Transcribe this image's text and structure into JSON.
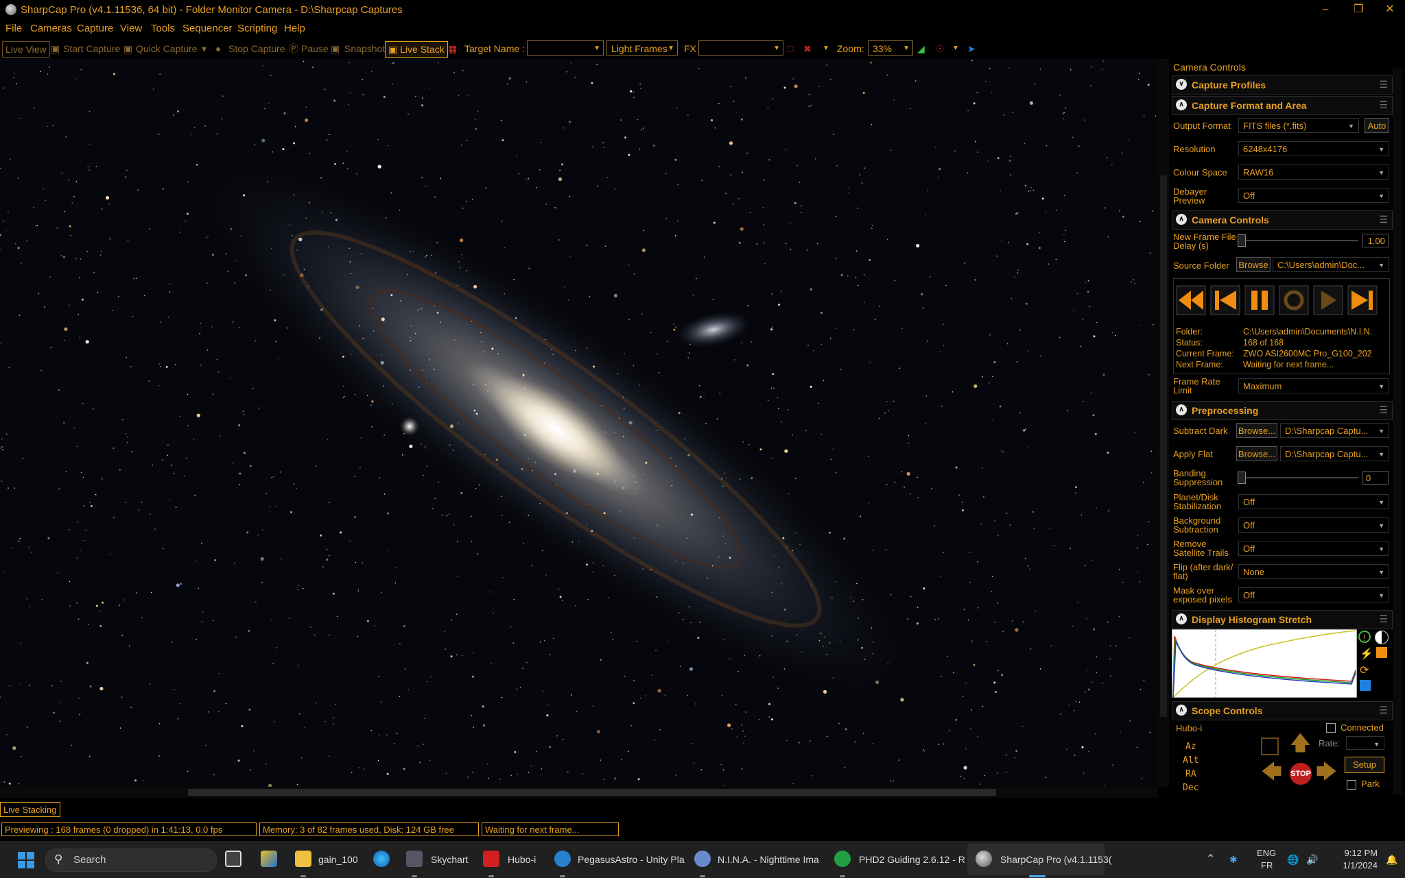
{
  "window": {
    "title": "SharpCap Pro (v4.1.11536, 64 bit) - Folder Monitor Camera - D:\\Sharpcap Captures"
  },
  "menu": [
    "File",
    "Cameras",
    "Capture",
    "View",
    "Tools",
    "Sequencer",
    "Scripting",
    "Help"
  ],
  "toolbar": {
    "live_view": "Live View",
    "start_capture": "Start Capture",
    "quick_capture": "Quick Capture",
    "stop_capture": "Stop Capture",
    "pause": "Pause",
    "snapshot": "Snapshot",
    "live_stack": "Live Stack",
    "target_name_label": "Target Name :",
    "target_name_value": "",
    "frame_type": "Light Frames",
    "fx_label": "FX",
    "fx_value": "",
    "zoom_label": "Zoom:",
    "zoom_value": "33%"
  },
  "panel": {
    "title": "Camera Controls",
    "capture_profiles": "Capture Profiles",
    "capture_format": {
      "header": "Capture Format and Area",
      "output_format_label": "Output Format",
      "output_format_value": "FITS files (*.fits)",
      "auto_button": "Auto",
      "resolution_label": "Resolution",
      "resolution_value": "6248x4176",
      "colour_space_label": "Colour Space",
      "colour_space_value": "RAW16",
      "debayer_label_1": "Debayer",
      "debayer_label_2": "Preview",
      "debayer_value": "Off"
    },
    "camera_controls": {
      "header": "Camera Controls",
      "new_frame_label_1": "New Frame File",
      "new_frame_label_2": "Delay (s)",
      "new_frame_value": "1.00",
      "source_folder_label": "Source Folder",
      "browse": "Browse",
      "source_folder_value": "C:\\Users\\admin\\Doc...",
      "folder_key": "Folder:",
      "folder_val": "C:\\Users\\admin\\Documents\\N.I.N.",
      "status_key": "Status:",
      "status_val": "168 of 168",
      "current_key": "Current Frame:",
      "current_val": "ZWO ASI2600MC Pro_G100_202",
      "next_key": "Next Frame:",
      "next_val": "Waiting for next frame...",
      "frame_rate_label_1": "Frame Rate",
      "frame_rate_label_2": "Limit",
      "frame_rate_value": "Maximum"
    },
    "preprocessing": {
      "header": "Preprocessing",
      "subtract_dark_label": "Subtract Dark",
      "browse": "Browse...",
      "subtract_dark_value": "D:\\Sharpcap Captu...",
      "apply_flat_label": "Apply Flat",
      "apply_flat_value": "D:\\Sharpcap Captu...",
      "banding_label_1": "Banding",
      "banding_label_2": "Suppression",
      "banding_value": "0",
      "planet_label_1": "Planet/Disk",
      "planet_label_2": "Stabilization",
      "planet_value": "Off",
      "bg_label_1": "Background",
      "bg_label_2": "Subtraction",
      "bg_value": "Off",
      "sat_label_1": "Remove",
      "sat_label_2": "Satellite Trails",
      "sat_value": "Off",
      "flip_label_1": "Flip (after dark/",
      "flip_label_2": "flat)",
      "flip_value": "None",
      "mask_label_1": "Mask over",
      "mask_label_2": "exposed pixels",
      "mask_value": "Off"
    },
    "histogram": {
      "header": "Display Histogram Stretch"
    },
    "scope": {
      "header": "Scope Controls",
      "mount": "Hubo-i",
      "connected": "Connected",
      "rate": "Rate:",
      "az": "Az",
      "alt": "Alt",
      "ra": "RA",
      "dec": "Dec",
      "setup": "Setup",
      "park": "Park",
      "stop": "STOP"
    }
  },
  "status": {
    "live_stacking": "Live Stacking",
    "previewing": "Previewing : 168 frames (0 dropped) in 1:41:13, 0.0 fps",
    "memory": "Memory: 3 of 82 frames used, Disk: 124 GB free",
    "waiting": "Waiting for next frame..."
  },
  "taskbar": {
    "search": "Search",
    "apps": [
      "gain_100",
      "Skychart",
      "Hubo-i",
      "PegasusAstro - Unity Pla",
      "N.I.N.A. - Nighttime Ima",
      "PHD2 Guiding 2.6.12 - R",
      "SharpCap Pro (v4.1.1153("
    ],
    "lang_1": "ENG",
    "lang_2": "FR",
    "time": "9:12 PM",
    "date": "1/1/2024"
  },
  "colors": {
    "accent": "#e8a020",
    "background": "#000000",
    "taskbar": "#202020"
  }
}
